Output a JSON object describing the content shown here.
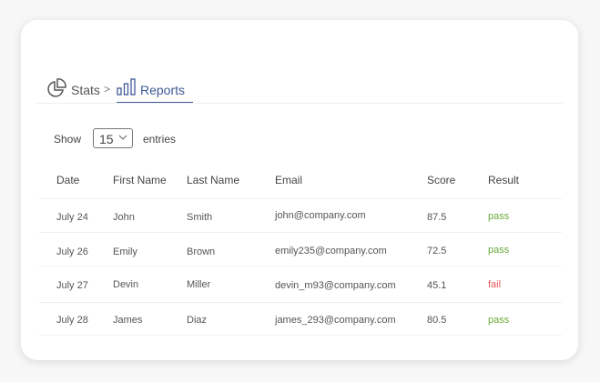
{
  "breadcrumb": {
    "items": [
      {
        "label": "Stats",
        "icon": "pie-chart-icon"
      },
      {
        "label": "Reports",
        "icon": "bar-chart-icon",
        "active": true
      }
    ],
    "separator": ">"
  },
  "entries": {
    "show_label": "Show",
    "value": "15",
    "suffix_label": "entries"
  },
  "table": {
    "columns": [
      "Date",
      "First Name",
      "Last Name",
      "Email",
      "Score",
      "Result"
    ],
    "rows": [
      [
        "July 24",
        "John",
        "Smith",
        "john@company.com",
        "87.5",
        "pass"
      ],
      [
        "July 26",
        "Emily",
        "Brown",
        "emily235@company.com",
        "72.5",
        "pass"
      ],
      [
        "July 27",
        "Devin",
        "Miller",
        "devin_m93@company.com",
        "45.1",
        "fail"
      ],
      [
        "July 28",
        "James",
        "Diaz",
        "james_293@company.com",
        "80.5",
        "pass"
      ]
    ]
  },
  "colors": {
    "accent": "#3f5a96",
    "pass": "#6aaa3a",
    "fail": "#e8555a"
  }
}
